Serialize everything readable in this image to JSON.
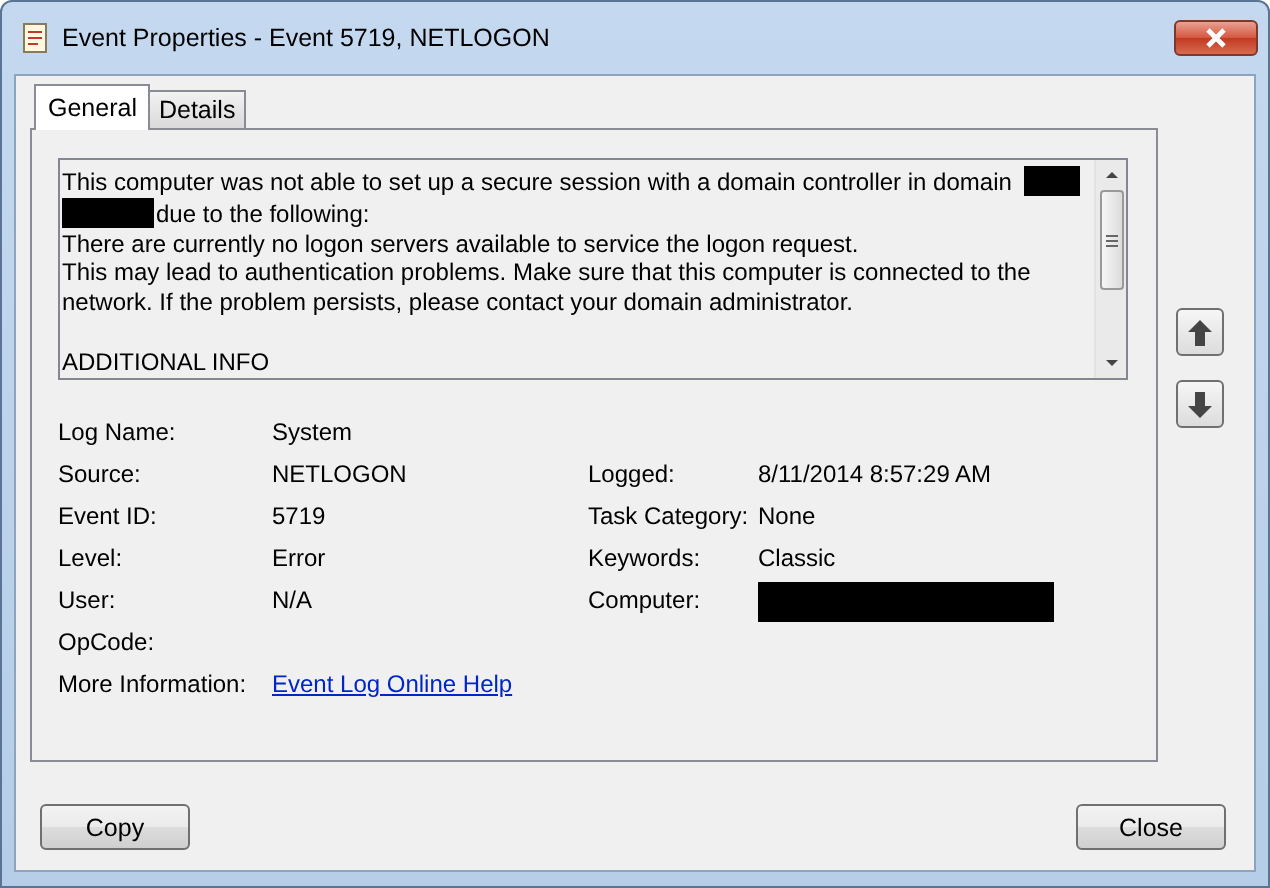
{
  "window": {
    "title": "Event Properties - Event 5719, NETLOGON"
  },
  "tabs": [
    {
      "label": "General",
      "selected": true
    },
    {
      "label": "Details",
      "selected": false
    }
  ],
  "description": {
    "lines": [
      {
        "gap_before": false,
        "segments": [
          {
            "kind": "text",
            "text": "This computer was not able to set up a secure session with a domain controller in domain"
          },
          {
            "kind": "redacted"
          },
          {
            "kind": "redacted"
          },
          {
            "kind": "text",
            "text": "due to the following:"
          }
        ]
      },
      {
        "gap_before": false,
        "segments": [
          {
            "kind": "text",
            "text": "There are currently no logon servers available to service the logon request."
          }
        ]
      },
      {
        "gap_before": false,
        "segments": [
          {
            "kind": "text",
            "text": "This may lead to authentication problems. Make sure that this computer is connected to the network. If the problem persists, please contact your domain administrator."
          }
        ]
      },
      {
        "gap_before": true,
        "segments": [
          {
            "kind": "text",
            "text": "ADDITIONAL INFO"
          }
        ]
      }
    ]
  },
  "fields": [
    {
      "label": "Log Name:",
      "value": {
        "kind": "text",
        "text": "System"
      }
    },
    {
      "label": "Source:",
      "value": {
        "kind": "text",
        "text": "NETLOGON"
      },
      "right": {
        "label": "Logged:",
        "value": {
          "kind": "text",
          "text": "8/11/2014 8:57:29 AM"
        }
      }
    },
    {
      "label": "Event ID:",
      "value": {
        "kind": "text",
        "text": "5719"
      },
      "right": {
        "label": "Task Category:",
        "value": {
          "kind": "text",
          "text": "None"
        }
      }
    },
    {
      "label": "Level:",
      "value": {
        "kind": "text",
        "text": "Error"
      },
      "right": {
        "label": "Keywords:",
        "value": {
          "kind": "text",
          "text": "Classic"
        }
      }
    },
    {
      "label": "User:",
      "value": {
        "kind": "text",
        "text": "N/A"
      },
      "right": {
        "label": "Computer:",
        "value": {
          "kind": "redacted"
        }
      }
    },
    {
      "label": "OpCode:"
    },
    {
      "label": "More Information:",
      "value": {
        "kind": "link",
        "text": "Event Log Online Help"
      }
    }
  ],
  "buttons": [
    "Copy",
    "Close"
  ]
}
